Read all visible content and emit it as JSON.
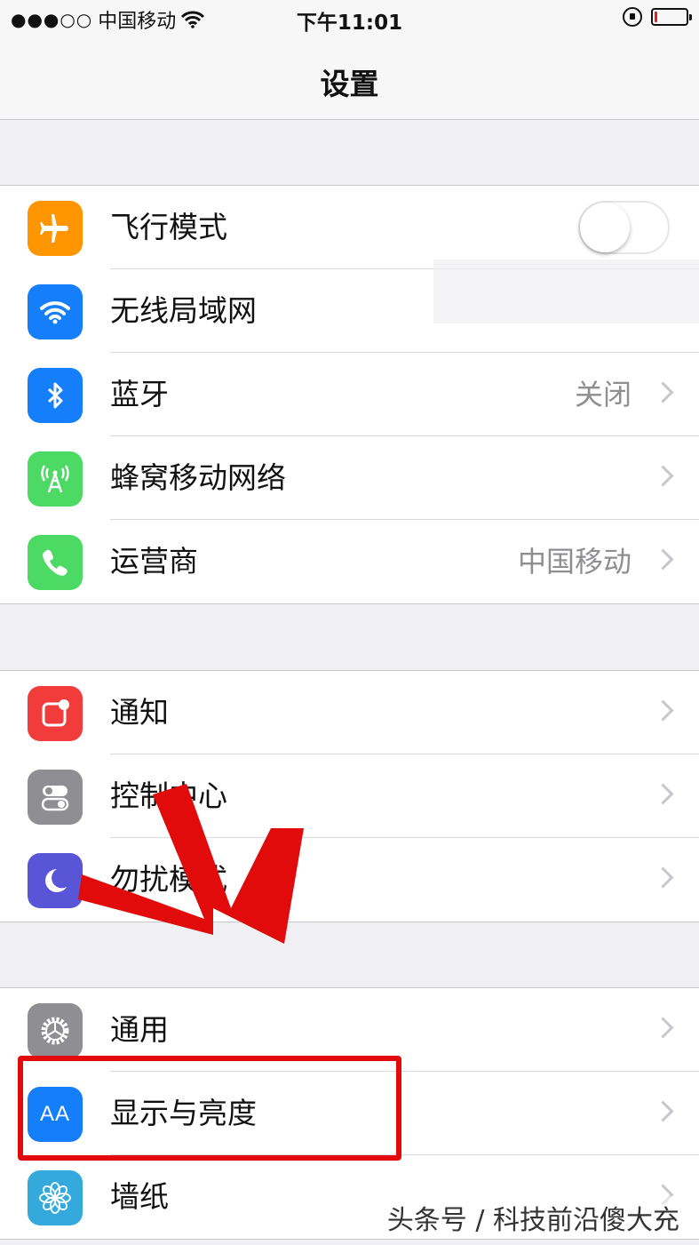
{
  "status_bar": {
    "signal": "●●●○○",
    "carrier": "中国移动",
    "time": "下午11:01",
    "battery_level_percent": 8
  },
  "nav": {
    "title": "设置"
  },
  "groups": [
    {
      "rows": [
        {
          "label": "飞行模式",
          "icon": "airplane-icon",
          "icon_color": "#ff9500",
          "control": "toggle",
          "toggle_on": false
        },
        {
          "label": "无线局域网",
          "icon": "wifi-icon",
          "icon_color": "#147efb",
          "value": "",
          "control": "chevron"
        },
        {
          "label": "蓝牙",
          "icon": "bluetooth-icon",
          "icon_color": "#147efb",
          "value": "关闭",
          "control": "chevron"
        },
        {
          "label": "蜂窝移动网络",
          "icon": "cellular-antenna-icon",
          "icon_color": "#4cd964",
          "value": "",
          "control": "chevron"
        },
        {
          "label": "运营商",
          "icon": "phone-icon",
          "icon_color": "#4cd964",
          "value": "中国移动",
          "control": "chevron"
        }
      ]
    },
    {
      "rows": [
        {
          "label": "通知",
          "icon": "notification-icon",
          "icon_color": "#f23c3c",
          "control": "chevron"
        },
        {
          "label": "控制中心",
          "icon": "control-center-icon",
          "icon_color": "#8e8e93",
          "control": "chevron"
        },
        {
          "label": "勿扰模式",
          "icon": "moon-icon",
          "icon_color": "#5856d6",
          "control": "chevron"
        }
      ]
    },
    {
      "rows": [
        {
          "label": "通用",
          "icon": "gear-icon",
          "icon_color": "#8e8e93",
          "control": "chevron"
        },
        {
          "label": "显示与亮度",
          "icon": "text-size-icon",
          "icon_color": "#147efb",
          "control": "chevron"
        },
        {
          "label": "墙纸",
          "icon": "flower-icon",
          "icon_color": "#34aadc",
          "control": "chevron"
        }
      ]
    }
  ],
  "icon_text": {
    "text_size": "AA"
  },
  "annotation": {
    "highlight_color": "#e10b0b",
    "arrow_color": "#e10b0b"
  },
  "watermark": "头条号 / 科技前沿傻大充"
}
